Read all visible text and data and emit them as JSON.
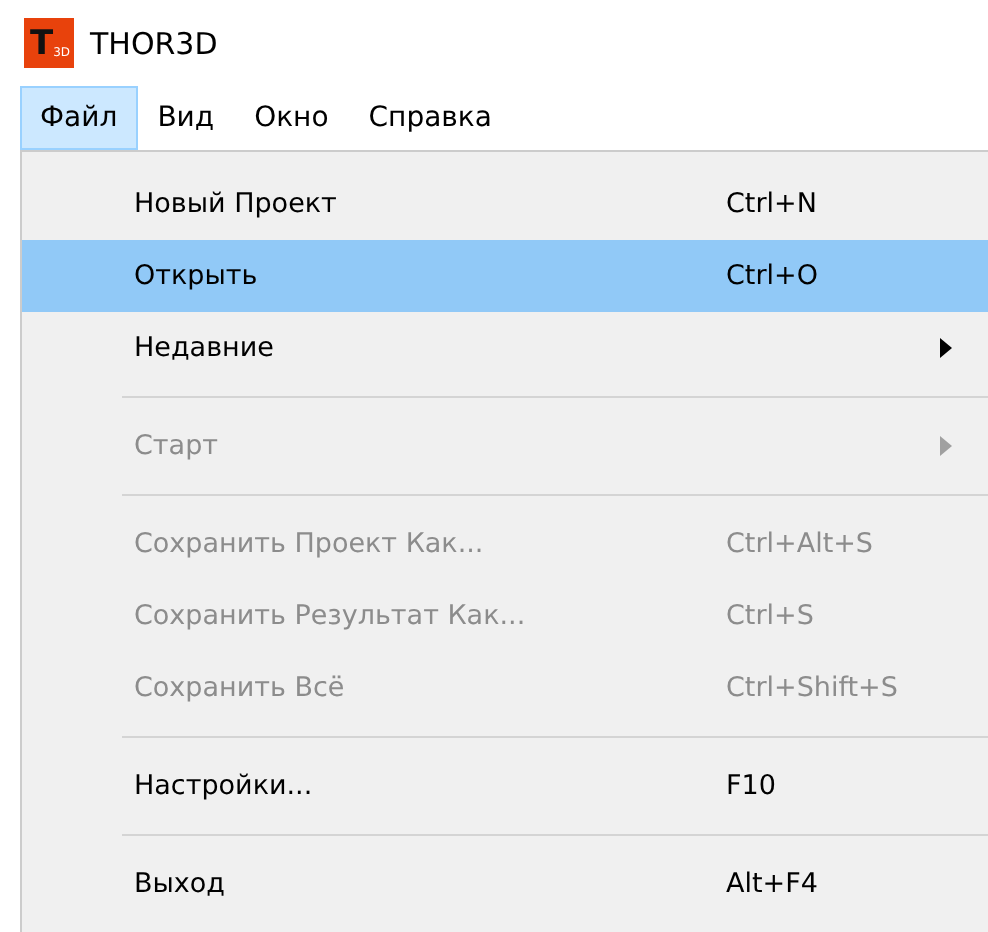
{
  "window": {
    "title": "THOR3D",
    "logo": {
      "letter": "T",
      "sub": "3D"
    }
  },
  "menubar": [
    {
      "label": "Файл",
      "selected": true
    },
    {
      "label": "Вид",
      "selected": false
    },
    {
      "label": "Окно",
      "selected": false
    },
    {
      "label": "Справка",
      "selected": false
    }
  ],
  "menu": [
    {
      "kind": "item",
      "label": "Новый Проект",
      "shortcut": "Ctrl+N",
      "selected": false,
      "disabled": false,
      "submenu": false
    },
    {
      "kind": "item",
      "label": "Открыть",
      "shortcut": "Ctrl+O",
      "selected": true,
      "disabled": false,
      "submenu": false
    },
    {
      "kind": "item",
      "label": "Недавние",
      "selected": false,
      "disabled": false,
      "submenu": true
    },
    {
      "kind": "separator"
    },
    {
      "kind": "item",
      "label": "Старт",
      "selected": false,
      "disabled": true,
      "submenu": true
    },
    {
      "kind": "separator"
    },
    {
      "kind": "item",
      "label": "Сохранить Проект Как...",
      "shortcut": "Ctrl+Alt+S",
      "selected": false,
      "disabled": true,
      "submenu": false
    },
    {
      "kind": "item",
      "label": "Сохранить Результат Как...",
      "shortcut": "Ctrl+S",
      "selected": false,
      "disabled": true,
      "submenu": false
    },
    {
      "kind": "item",
      "label": "Сохранить Всё",
      "shortcut": "Ctrl+Shift+S",
      "selected": false,
      "disabled": true,
      "submenu": false
    },
    {
      "kind": "separator"
    },
    {
      "kind": "item",
      "label": "Настройки...",
      "shortcut": "F10",
      "selected": false,
      "disabled": false,
      "submenu": false
    },
    {
      "kind": "separator"
    },
    {
      "kind": "item",
      "label": "Выход",
      "shortcut": "Alt+F4",
      "selected": false,
      "disabled": false,
      "submenu": false
    }
  ]
}
